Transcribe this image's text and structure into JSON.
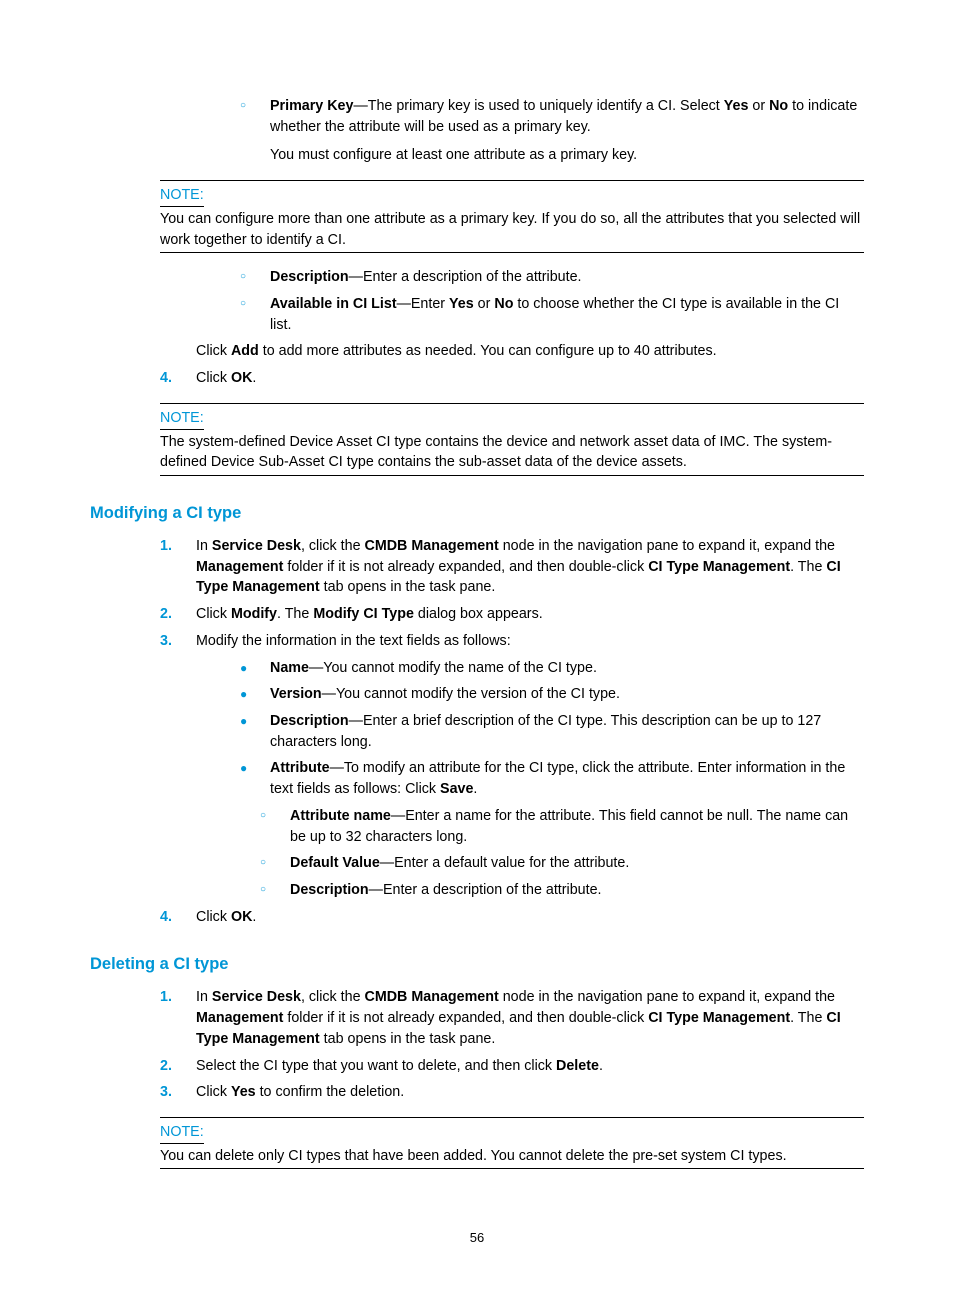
{
  "pageNumber": "56",
  "top": {
    "pk_label": "Primary Key",
    "pk_text": "—The primary key is used to uniquely identify a CI. Select ",
    "pk_yes": "Yes",
    "pk_or": " or ",
    "pk_no": "No",
    "pk_text2": " to indicate whether the attribute will be used as a primary key.",
    "pk_para2": "You must configure at least one attribute as a primary key."
  },
  "note1": {
    "label": "NOTE:",
    "body": "You can configure more than one attribute as a primary key. If you do so, all the attributes that you selected will work together to identify a CI."
  },
  "mid": {
    "desc_label": "Description",
    "desc_text": "—Enter a description of the attribute.",
    "avail_label": "Available in CI List",
    "avail_text1": "—Enter ",
    "avail_yes": "Yes",
    "avail_or": " or ",
    "avail_no": "No",
    "avail_text2": " to choose whether the CI type is available in the CI list.",
    "click_add_1": "Click ",
    "click_add_b": "Add",
    "click_add_2": " to add more attributes as needed. You can configure up to 40 attributes.",
    "step4_num": "4.",
    "step4_1": "Click ",
    "step4_b": "OK",
    "step4_2": "."
  },
  "note2": {
    "label": "NOTE:",
    "body": "The system-defined Device Asset CI type contains the device and network asset data of IMC. The system-defined Device Sub-Asset CI type contains the sub-asset data of the device assets."
  },
  "modify": {
    "heading": "Modifying a CI type",
    "s1_num": "1.",
    "s1_a": "In ",
    "s1_b1": "Service Desk",
    "s1_c": ", click the ",
    "s1_b2": "CMDB Management",
    "s1_d": " node in the navigation pane to expand it, expand the ",
    "s1_b3": "Management",
    "s1_e": " folder if it is not already expanded, and then double-click ",
    "s1_b4": "CI Type Management",
    "s1_f": ". The ",
    "s1_b5": "CI Type Management",
    "s1_g": " tab opens in the task pane.",
    "s2_num": "2.",
    "s2_a": "Click ",
    "s2_b1": "Modify",
    "s2_c": ". The ",
    "s2_b2": "Modify CI Type",
    "s2_d": " dialog box appears.",
    "s3_num": "3.",
    "s3_a": "Modify the information in the text fields as follows:",
    "b_name_l": "Name",
    "b_name_t": "—You cannot modify the name of the CI type.",
    "b_ver_l": "Version",
    "b_ver_t": "—You cannot modify the version of the CI type.",
    "b_desc_l": "Description",
    "b_desc_t": "—Enter a brief description of the CI type. This description can be up to 127 characters long.",
    "b_attr_l": "Attribute",
    "b_attr_t1": "—To modify an attribute for the CI type, click the attribute. Enter information in the text fields as follows: Click ",
    "b_attr_b": "Save",
    "b_attr_t2": ".",
    "sb_an_l": "Attribute name",
    "sb_an_t": "—Enter a name for the attribute. This field cannot be null. The name can be up to 32 characters long.",
    "sb_dv_l": "Default Value",
    "sb_dv_t": "—Enter a default value for the attribute.",
    "sb_desc_l": "Description",
    "sb_desc_t": "—Enter a description of the attribute.",
    "s4_num": "4.",
    "s4_a": "Click ",
    "s4_b": "OK",
    "s4_c": "."
  },
  "delete": {
    "heading": "Deleting a CI type",
    "s1_num": "1.",
    "s1_a": "In ",
    "s1_b1": "Service Desk",
    "s1_c": ", click the ",
    "s1_b2": "CMDB Management",
    "s1_d": " node in the navigation pane to expand it, expand the ",
    "s1_b3": "Management",
    "s1_e": " folder if it is not already expanded, and then double-click ",
    "s1_b4": "CI Type Management",
    "s1_f": ". The ",
    "s1_b5": "CI Type Management",
    "s1_g": " tab opens in the task pane.",
    "s2_num": "2.",
    "s2_a": "Select the CI type that you want to delete, and then click ",
    "s2_b": "Delete",
    "s2_c": ".",
    "s3_num": "3.",
    "s3_a": "Click ",
    "s3_b": "Yes",
    "s3_c": " to confirm the deletion."
  },
  "note3": {
    "label": "NOTE:",
    "body": "You can delete only CI types that have been added. You cannot delete the pre-set system CI types."
  }
}
